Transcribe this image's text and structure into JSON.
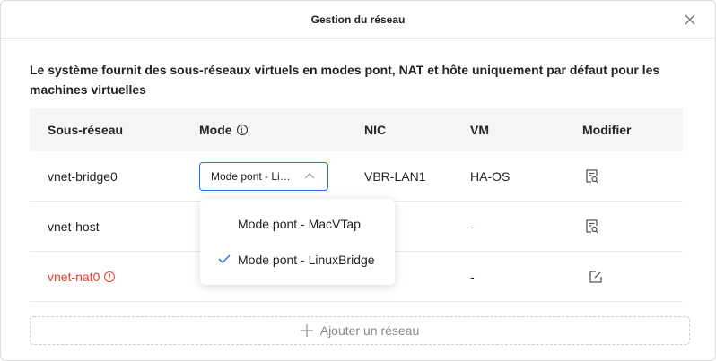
{
  "dialog": {
    "title": "Gestion du réseau",
    "description": "Le système fournit des sous-réseaux virtuels en modes pont, NAT et hôte uniquement par défaut pour les machines virtuelles"
  },
  "table": {
    "headers": [
      "Sous-réseau",
      "Mode",
      "NIC",
      "VM",
      "Modifier"
    ],
    "rows": [
      {
        "subnet": "vnet-bridge0",
        "mode": "Mode pont - Li…",
        "nic": "VBR-LAN1",
        "vm": "HA-OS",
        "action": "view"
      },
      {
        "subnet": "vnet-host",
        "mode": "",
        "nic": "",
        "vm": "-",
        "action": "view"
      },
      {
        "subnet": "vnet-nat0",
        "mode": "",
        "nic": "",
        "vm": "-",
        "action": "edit",
        "warning": true
      }
    ]
  },
  "dropdown": {
    "options": [
      "Mode pont - MacVTap",
      "Mode pont - LinuxBridge"
    ],
    "selected": "Mode pont - LinuxBridge"
  },
  "add_label": "Ajouter un réseau",
  "colors": {
    "accent": "#2f6fe4",
    "error": "#e5412d"
  }
}
